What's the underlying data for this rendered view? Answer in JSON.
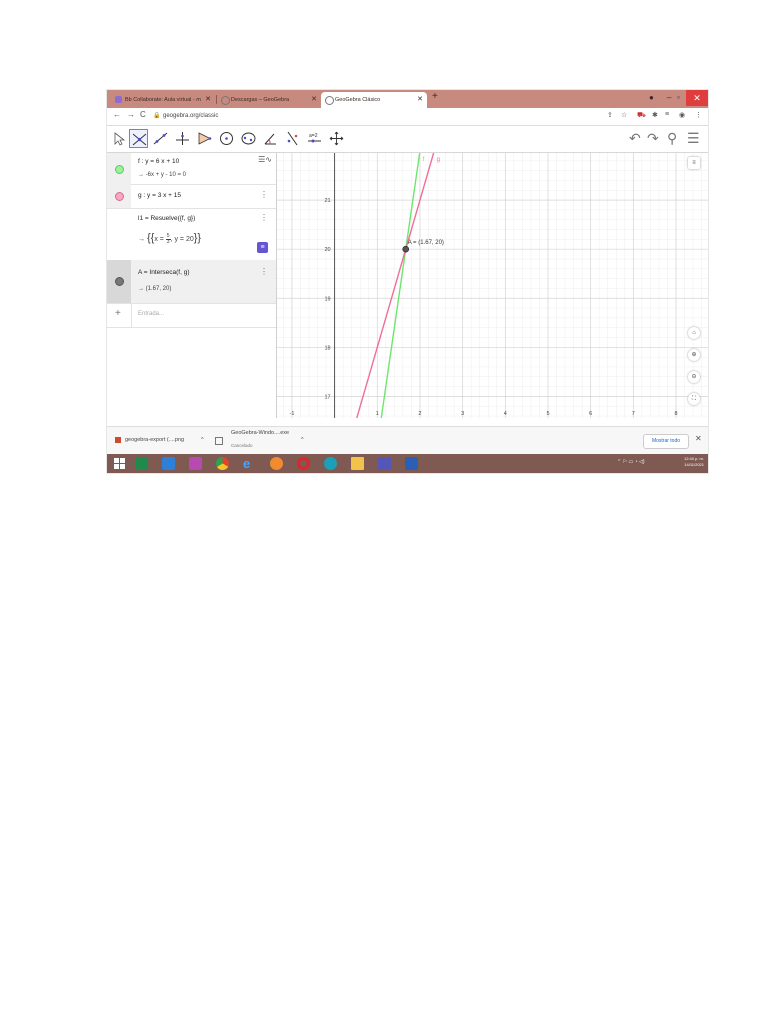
{
  "browser": {
    "tabs": [
      {
        "label": "Bb Collaborate: Aula virtual - m",
        "icon": "collaborate-icon",
        "color": "#8e6cd0"
      },
      {
        "label": "Descargas – GeoGebra",
        "icon": "geogebra-icon",
        "color": "#999999"
      },
      {
        "label": "GeoGebra Clásico",
        "icon": "geogebra-icon",
        "color": "#999999"
      }
    ],
    "url": "geogebra.org/classic"
  },
  "algebra": {
    "rows": [
      {
        "expr": "f : y = 6 x + 10",
        "output": "→ -6x + y - 10 = 0",
        "color": "#6ee66e"
      },
      {
        "expr": "g : y = 3 x + 15",
        "color": "#f06e9a"
      },
      {
        "expr": "l1 = Resuelve({f, g})",
        "output_prefix": "→",
        "frac_num": "5",
        "frac_den": "3",
        "output_rest": ", y = 20"
      },
      {
        "expr": "A = Interseca(f, g)",
        "output": "→ (1.67, 20)",
        "color": "#777777"
      }
    ],
    "input_placeholder": "Entrada..."
  },
  "graphics": {
    "point_label": "A = (1.67, 20)",
    "x_ticks": [
      "-1",
      "1",
      "2",
      "3",
      "4",
      "5",
      "6",
      "7",
      "8"
    ],
    "y_ticks": [
      "17",
      "18",
      "19",
      "20",
      "21"
    ],
    "line_labels": {
      "f": "f",
      "g": "g"
    },
    "colors": {
      "f": "#6ee66e",
      "g": "#f06e9a"
    }
  },
  "downloads": [
    {
      "name": "geogebra-export (....png"
    },
    {
      "name": "GeoGebra-Windo....exe",
      "status": "Cancelado"
    }
  ],
  "download_show_all": "Mostrar todo",
  "taskbar": {
    "time": "12:40 p. m.",
    "date": "14/11/2021"
  }
}
